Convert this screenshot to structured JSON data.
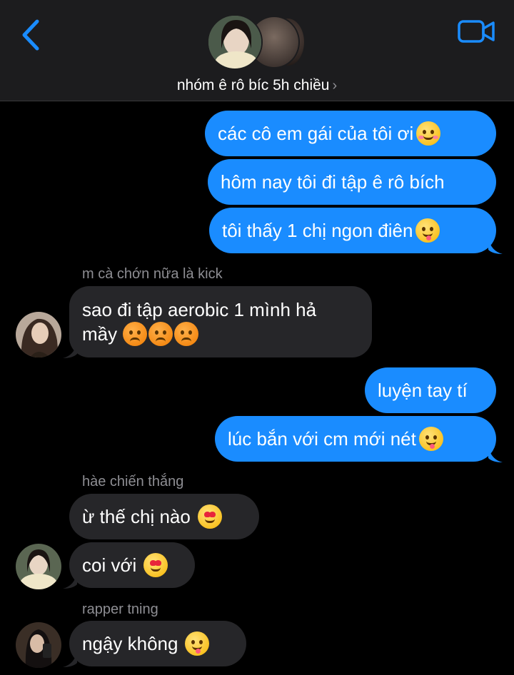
{
  "header": {
    "group_name": "nhóm ê rô bíc 5h chiều",
    "chevron": "›",
    "back_icon": "chevron-left-icon",
    "video_icon": "video-camera-icon"
  },
  "colors": {
    "accent": "#1a8cff",
    "incoming_bubble": "#262629",
    "background": "#000000",
    "header_bg": "#1c1c1e",
    "sender_name": "#8e8e93"
  },
  "messages": [
    {
      "direction": "out",
      "text": "các cô em gái của tôi ơi",
      "emojis": [
        "smiling-face-with-hearts"
      ]
    },
    {
      "direction": "out",
      "text": "hôm nay tôi đi tập ê rô bích",
      "emojis": []
    },
    {
      "direction": "out",
      "text": "tôi thấy 1 chị ngon điên",
      "emojis": [
        "face-savoring-food"
      ]
    },
    {
      "direction": "in",
      "sender": "m cà chớn nữa là kick",
      "text_line1": "sao đi tập aerobic 1 mình hả",
      "text_line2": "mầy",
      "emojis": [
        "pouting-face",
        "pouting-face",
        "pouting-face"
      ]
    },
    {
      "direction": "out",
      "text": "luyện tay tí",
      "emojis": []
    },
    {
      "direction": "out",
      "text": "lúc bắn với cm mới nét",
      "emojis": [
        "face-savoring-food"
      ]
    },
    {
      "direction": "in",
      "sender": "hàe chiến thắng",
      "text": "ừ thế chị nào",
      "emojis": [
        "smiling-face-with-heart-eyes"
      ]
    },
    {
      "direction": "in",
      "text": "coi với",
      "emojis": [
        "smiling-face-with-heart-eyes"
      ]
    },
    {
      "direction": "in",
      "sender": "rapper tning",
      "text": "ngậy không",
      "emojis": [
        "face-savoring-food"
      ]
    }
  ]
}
